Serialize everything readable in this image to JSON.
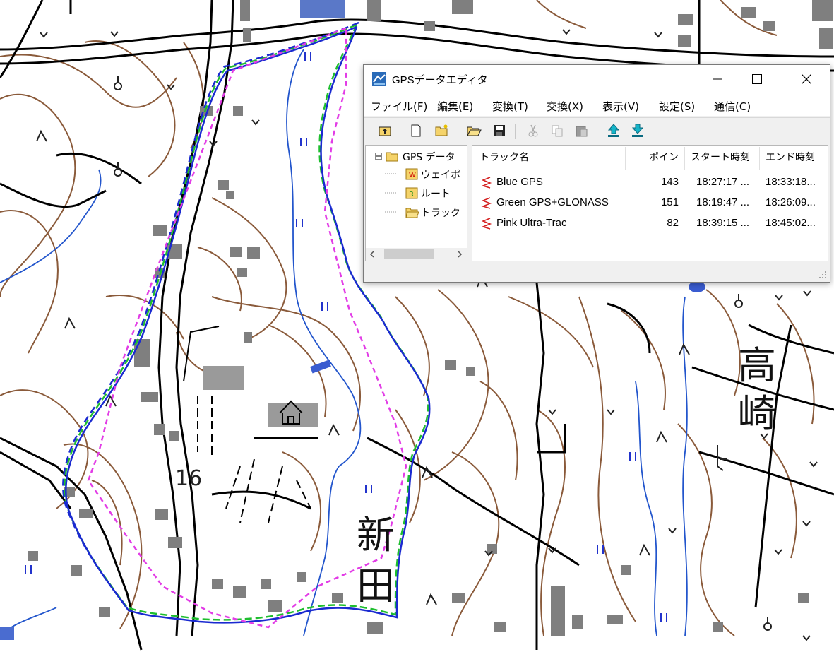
{
  "window": {
    "title": "GPSデータエディタ",
    "controls": [
      "minimize",
      "maximize",
      "close"
    ]
  },
  "menu": [
    "ファイル(F)",
    "編集(E)",
    "変換(T)",
    "交換(X)",
    "表示(V)",
    "設定(S)",
    "通信(C)"
  ],
  "toolbar_icons": [
    "up-folder-icon",
    "new-file-icon",
    "new-folder-icon",
    "open-folder-icon",
    "save-icon",
    "cut-icon",
    "copy-icon",
    "paste-icon",
    "upload-icon",
    "download-icon"
  ],
  "tree": {
    "root": "GPS データ",
    "children": [
      "ウェイポ",
      "ルート",
      "トラック"
    ]
  },
  "list": {
    "columns": [
      "トラック名",
      "ポイン",
      "スタート時刻",
      "エンド時刻"
    ],
    "rows": [
      {
        "name": "Blue GPS",
        "points": "143",
        "start": "18:27:17 ...",
        "end": "18:33:18..."
      },
      {
        "name": "Green GPS+GLONASS",
        "points": "151",
        "start": "18:19:47 ...",
        "end": "18:26:09..."
      },
      {
        "name": "Pink Ultra-Trac",
        "points": "82",
        "start": "18:39:15 ...",
        "end": "18:45:02..."
      }
    ]
  },
  "map": {
    "labels": {
      "shinden_1": "新",
      "shinden_2": "田",
      "takasaki_1": "高",
      "takasaki_2": "崎",
      "elevation": "16"
    },
    "track_colors": {
      "blue": "#1a3fd6",
      "green": "#1ebe2e",
      "pink": "#e23ce6"
    }
  }
}
